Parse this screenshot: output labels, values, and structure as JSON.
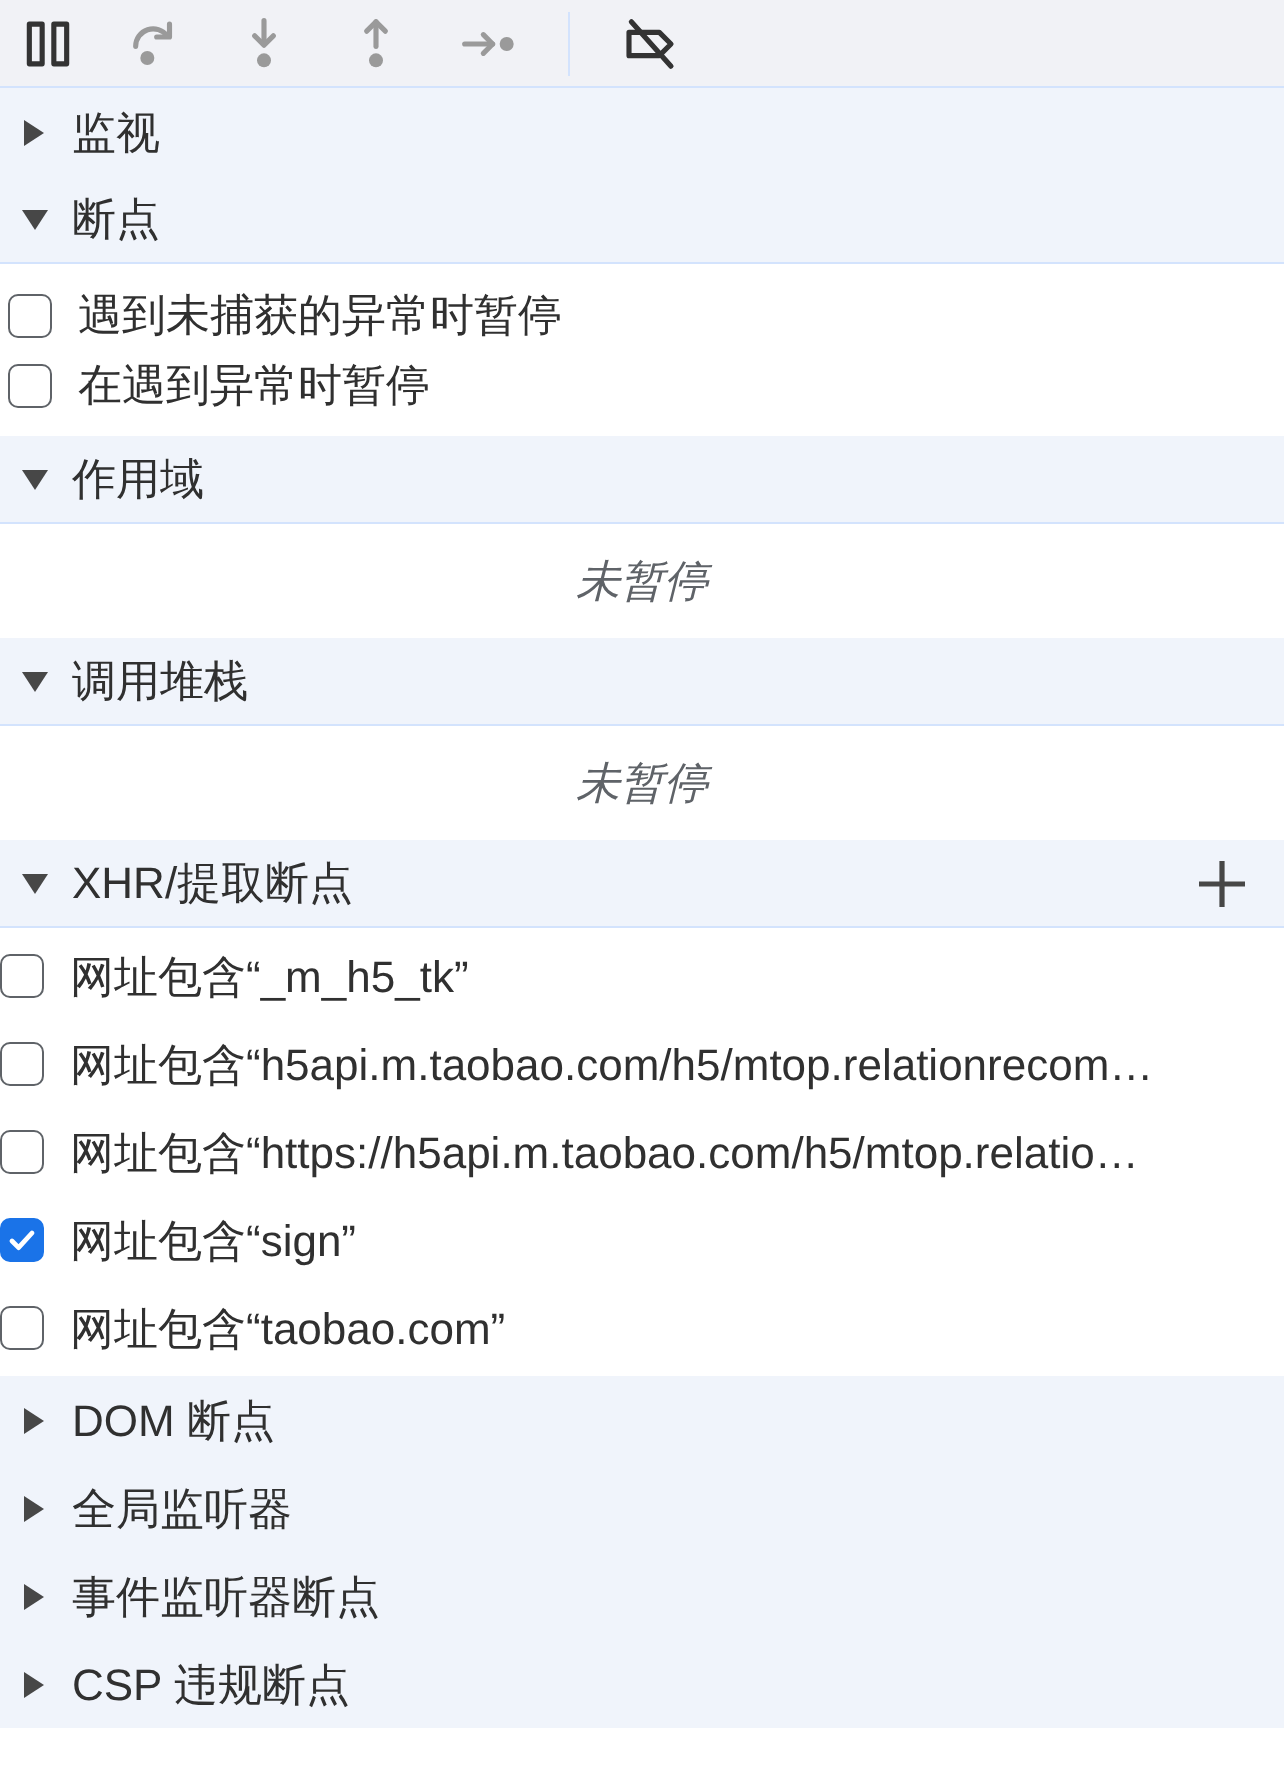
{
  "toolbar": {
    "buttons": [
      {
        "kind": "pause",
        "disabled": false
      },
      {
        "kind": "stepover",
        "disabled": true
      },
      {
        "kind": "stepinto",
        "disabled": true
      },
      {
        "kind": "stepout",
        "disabled": true
      },
      {
        "kind": "step",
        "disabled": true
      },
      {
        "kind": "deactivate",
        "disabled": false
      }
    ]
  },
  "sections": [
    {
      "title": "监视",
      "expanded": false
    },
    {
      "title": "断点",
      "expanded": true,
      "items": [
        {
          "label": "遇到未捕获的异常时暂停",
          "checked": false
        },
        {
          "label": "在遇到异常时暂停",
          "checked": false
        }
      ]
    },
    {
      "title": "作用域",
      "expanded": true,
      "message": "未暂停"
    },
    {
      "title": "调用堆栈",
      "expanded": true,
      "message": "未暂停"
    },
    {
      "title": "XHR/提取断点",
      "expanded": true,
      "add_button": true,
      "items": [
        {
          "label": "网址包含“_m_h5_tk”",
          "checked": false
        },
        {
          "label": "网址包含“h5api.m.taobao.com/h5/mtop.relationrecom…",
          "checked": false
        },
        {
          "label": "网址包含“https://h5api.m.taobao.com/h5/mtop.relatio…",
          "checked": false
        },
        {
          "label": "网址包含“sign”",
          "checked": true
        },
        {
          "label": "网址包含“taobao.com”",
          "checked": false
        }
      ]
    },
    {
      "title": "DOM 断点",
      "expanded": false
    },
    {
      "title": "全局监听器",
      "expanded": false
    },
    {
      "title": "事件监听器断点",
      "expanded": false
    },
    {
      "title": "CSP 违规断点",
      "expanded": false
    }
  ]
}
